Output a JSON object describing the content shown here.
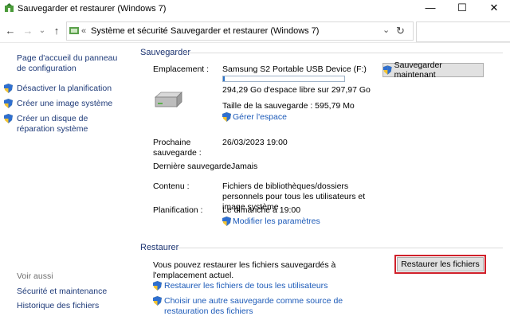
{
  "window": {
    "title": "Sauvegarder et restaurer (Windows 7)",
    "minimize": "—",
    "maximize": "☐",
    "close": "✕"
  },
  "nav": {
    "back": "←",
    "forward": "→",
    "dropdown": "⌄",
    "up": "↑",
    "overflow": "«",
    "breadcrumb": [
      "Système et sécurité",
      "Sauvegarder et restaurer (Windows 7)"
    ],
    "separator": ">",
    "address_dropdown": "⌄",
    "refresh": "↻",
    "search_placeholder": ""
  },
  "sidebar": {
    "home_link": "Page d'accueil du panneau de configuration",
    "items": [
      {
        "label": "Désactiver la planification"
      },
      {
        "label": "Créer une image système"
      },
      {
        "label": "Créer un disque de réparation système"
      }
    ],
    "see_also_title": "Voir aussi",
    "see_also": [
      "Sécurité et maintenance",
      "Historique des fichiers"
    ]
  },
  "backup": {
    "section_title": "Sauvegarder",
    "location_label": "Emplacement :",
    "location_value": "Samsung S2 Portable USB Device (F:)",
    "backup_now_button": "Sauvegarder maintenant",
    "free_space": "294,29 Go d'espace libre sur 297,97 Go",
    "used_fraction": 0.012,
    "backup_size": "Taille de la sauvegarde : 595,79 Mo",
    "manage_space_link": "Gérer l'espace",
    "next_label": "Prochaine sauvegarde :",
    "next_value": "26/03/2023 19:00",
    "last_label": "Dernière sauvegarde",
    "last_value": "Jamais",
    "content_label": "Contenu :",
    "content_value": "Fichiers de bibliothèques/dossiers personnels pour tous les utilisateurs et image système",
    "schedule_label": "Planification :",
    "schedule_value": "Le dimanche à 19:00",
    "change_settings_link": "Modifier les paramètres"
  },
  "restore": {
    "section_title": "Restaurer",
    "description": "Vous pouvez restaurer les fichiers sauvegardés à l'emplacement actuel.",
    "restore_button": "Restaurer les fichiers",
    "restore_all_link": "Restaurer les fichiers de tous les utilisateurs",
    "choose_other_link": "Choisir une autre sauvegarde comme source de restauration des fichiers"
  },
  "colors": {
    "link": "#1c5ab8",
    "heading": "#1a3270",
    "highlight_border": "#d0202a",
    "progress_fill": "#2b73c8"
  }
}
